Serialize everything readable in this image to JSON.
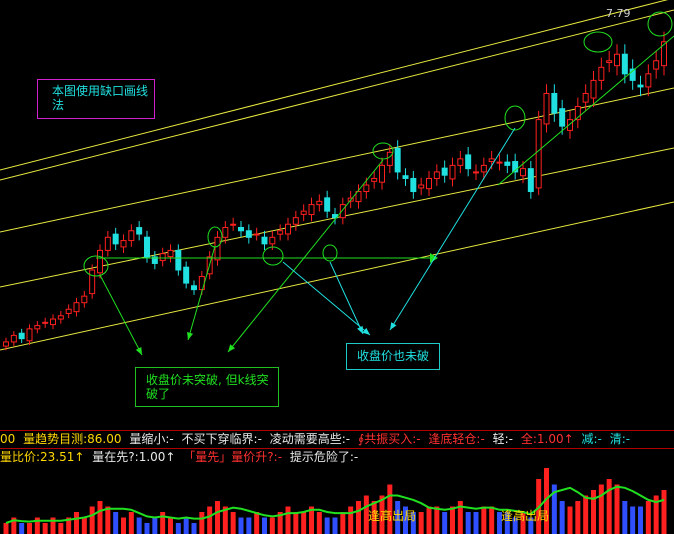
{
  "price_label": "7.79",
  "notes": {
    "main": "本图使用缺口画线\n法",
    "close_not_break_1": "收盘价未突破, 但k线突\n破了",
    "close_not_break_2": "收盘价也未破"
  },
  "indicator_row1": {
    "t0": "00",
    "t1": "量趋势目测:86.00",
    "t2": "量缩小:-",
    "t3": "不买下穿临界:-",
    "t4": "凌动需要高些:-",
    "t5": "∮共振买入:-",
    "t6": "逢底轻仓:-",
    "t7": "轻:-",
    "t8": "全:1.00↑",
    "t9": "减:-",
    "t10": "清:-"
  },
  "indicator_row2": {
    "t1": "量比价:23.51↑",
    "t2": "量在先?:1.00↑",
    "t3": "「量先」量价升?:-",
    "t4": "提示危险了:-"
  },
  "volume_tags": [
    "逢高出局",
    "逢高出局"
  ],
  "colors": {
    "up": "#ff2020",
    "down": "#20e0e0",
    "yellow_line": "#e8e840",
    "green_line": "#20e020",
    "cyan_arrow": "#20e0e0"
  },
  "chart_data": {
    "type": "candlestick",
    "price_label": 7.79,
    "candles_close": [
      3.2,
      3.3,
      3.25,
      3.4,
      3.45,
      3.5,
      3.55,
      3.6,
      3.7,
      3.8,
      3.9,
      4.3,
      4.6,
      4.8,
      4.7,
      4.75,
      4.9,
      4.85,
      4.5,
      4.4,
      4.55,
      4.6,
      4.3,
      4.1,
      4.0,
      4.2,
      4.5,
      4.8,
      4.95,
      5.0,
      4.9,
      4.8,
      4.85,
      4.7,
      4.8,
      4.9,
      5.0,
      5.1,
      5.2,
      5.3,
      5.35,
      5.2,
      5.1,
      5.3,
      5.4,
      5.5,
      5.6,
      5.7,
      5.9,
      6.1,
      5.8,
      5.7,
      5.5,
      5.6,
      5.7,
      5.8,
      5.75,
      5.9,
      6.0,
      5.85,
      5.8,
      5.9,
      6.0,
      5.95,
      5.9,
      5.8,
      5.85,
      5.5,
      6.6,
      7.0,
      6.7,
      6.5,
      6.6,
      6.8,
      7.0,
      7.2,
      7.4,
      7.5,
      7.6,
      7.3,
      7.2,
      7.1,
      7.3,
      7.5,
      7.79
    ],
    "volume": [
      2,
      3,
      2,
      2,
      3,
      2,
      3,
      2,
      3,
      4,
      3,
      5,
      6,
      5,
      4,
      3,
      4,
      3,
      2,
      3,
      4,
      3,
      2,
      3,
      2,
      4,
      5,
      6,
      5,
      4,
      3,
      3,
      4,
      3,
      3,
      4,
      5,
      4,
      4,
      5,
      4,
      3,
      3,
      4,
      5,
      6,
      7,
      6,
      7,
      9,
      6,
      5,
      4,
      4,
      5,
      5,
      4,
      5,
      6,
      4,
      4,
      5,
      5,
      4,
      4,
      3,
      4,
      3,
      10,
      12,
      9,
      6,
      5,
      6,
      7,
      8,
      9,
      10,
      9,
      6,
      5,
      5,
      6,
      7,
      8
    ]
  }
}
